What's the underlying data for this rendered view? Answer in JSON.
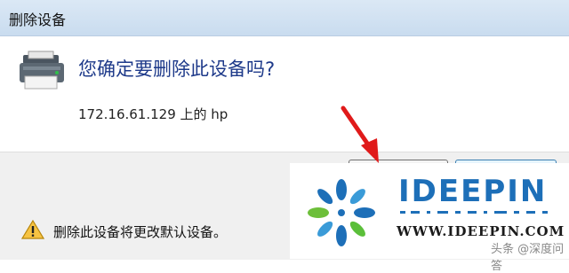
{
  "dialog": {
    "title": "删除设备",
    "question": "您确定要删除此设备吗?",
    "device_line": "172.16.61.129 上的 hp",
    "warning": "删除此设备将更改默认设备。"
  },
  "watermark": {
    "brand": "IDEEPIN",
    "url": "WWW.IDEEPIN.COM",
    "credit": "头条 @深度问答"
  },
  "colors": {
    "question_text": "#1e3a8a",
    "arrow": "#e01a1a",
    "brand": "#1d6fb8"
  },
  "icons": {
    "device": "printer-icon",
    "warning": "warning-icon",
    "pointer": "red-arrow-icon"
  }
}
